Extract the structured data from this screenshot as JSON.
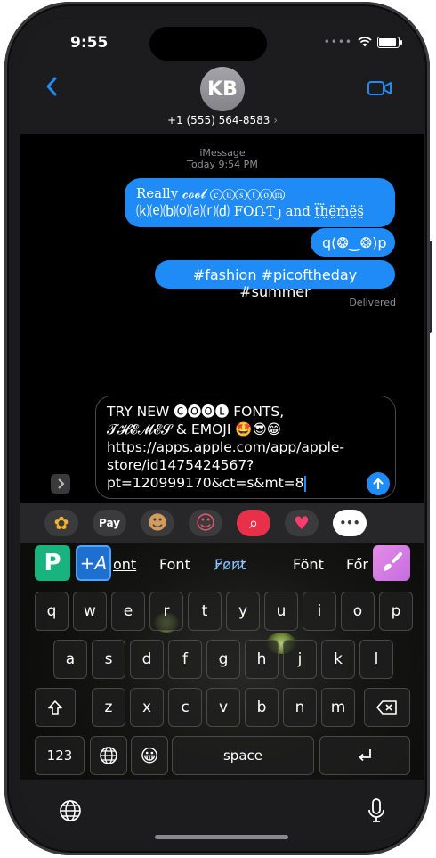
{
  "status": {
    "time": "9:55"
  },
  "header": {
    "avatar_initials": "KB",
    "phone": "+1 (555) 564-8583",
    "chevron": "›"
  },
  "thread": {
    "service": "iMessage",
    "timestamp": "Today 9:54 PM",
    "messages": [
      {
        "line1": "Really 𝓬𝓸𝓸𝓵 ⓒⓤⓢⓣⓞⓜ",
        "line2": "⒦⒠⒝⒪⒜⒭⒟ FOՌƬ᧒ and ẗ̤ḧ̤ë̤m̤̈ë̤s̤̈"
      },
      {
        "text": "q(❂‿❂)p"
      },
      {
        "text": "#fashion #picoftheday #summer"
      }
    ],
    "delivered": "Delivered"
  },
  "input": {
    "lines": [
      "TRY NEW 🅒🅞🅞🅛 FONTS,",
      "𝓣𝓗𝓔𝓜𝓔𝓢 & EMOJI 🤩😎😁",
      "https://apps.apple.com/app/apple-",
      "store/id1475424567?",
      "pt=120999170&ct=s&mt=8"
    ]
  },
  "app_strip": {
    "items": [
      {
        "name": "photos",
        "glyph": "✿"
      },
      {
        "name": "apple-pay",
        "glyph": "Pay"
      },
      {
        "name": "memoji",
        "glyph": "☻"
      },
      {
        "name": "memoji-stickers",
        "glyph": "☺"
      },
      {
        "name": "web-images",
        "glyph": "⌕"
      },
      {
        "name": "digital-touch",
        "glyph": "♥"
      },
      {
        "name": "more",
        "glyph": "•••"
      }
    ]
  },
  "keyboard": {
    "font_options": [
      "ont",
      "Font",
      "F̷o̷n̷t̷",
      "Fönt",
      "Főr"
    ],
    "p_button": "P",
    "a_button": "+A",
    "row1": [
      "q",
      "w",
      "e",
      "r",
      "t",
      "y",
      "u",
      "i",
      "o",
      "p"
    ],
    "row2": [
      "a",
      "s",
      "d",
      "f",
      "g",
      "h",
      "j",
      "k",
      "l"
    ],
    "row3": [
      "z",
      "x",
      "c",
      "v",
      "b",
      "n",
      "m"
    ],
    "numbers_key": "123",
    "space_key": "space",
    "emoji_key": "😀"
  },
  "colors": {
    "bubble": "#1f8bf7",
    "background": "#000000",
    "accent_green": "#18b37e"
  }
}
